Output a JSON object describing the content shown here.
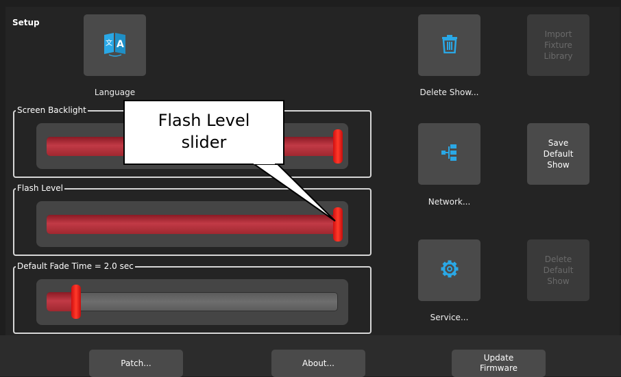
{
  "window": {
    "title": "Setup"
  },
  "tiles": {
    "language": {
      "label": "Language",
      "icon": "language-icon"
    },
    "delete_show": {
      "label": "Delete Show...",
      "icon": "trash-icon"
    },
    "import_fixture": {
      "line1": "Import",
      "line2": "Fixture",
      "line3": "Library"
    },
    "network": {
      "label": "Network...",
      "icon": "network-icon"
    },
    "save_default": {
      "line1": "Save",
      "line2": "Default",
      "line3": "Show"
    },
    "service": {
      "label": "Service...",
      "icon": "gear-icon"
    },
    "delete_default": {
      "line1": "Delete",
      "line2": "Default",
      "line3": "Show"
    }
  },
  "sliders": {
    "backlight": {
      "label": "Screen Backlight",
      "value": 1.0
    },
    "flash": {
      "label": "Flash Level",
      "value": 1.0
    },
    "fade": {
      "label": "Default Fade Time = 2.0 sec",
      "value": 0.1
    }
  },
  "bottom_bar": {
    "patch": "Patch...",
    "about": "About...",
    "update_line1": "Update",
    "update_line2": "Firmware"
  },
  "callout": {
    "line1": "Flash Level",
    "line2": "slider"
  },
  "colors": {
    "accent_blue": "#2aa8e6",
    "slider_red": "#e0201c"
  }
}
